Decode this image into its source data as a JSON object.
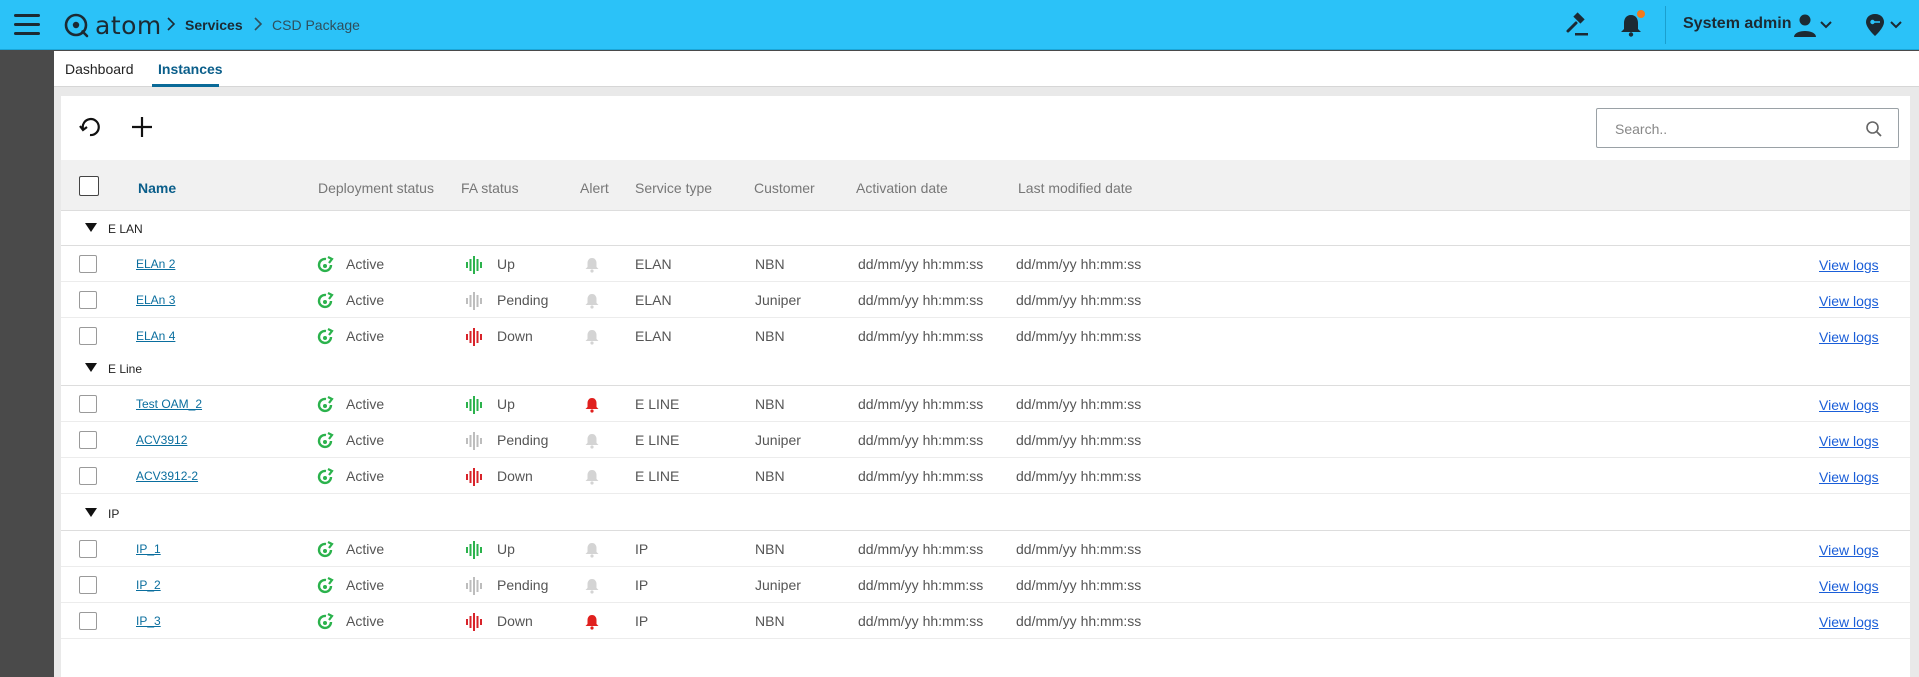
{
  "header": {
    "logo_text": "atom",
    "breadcrumb": [
      "Services",
      "CSD Package"
    ],
    "user_name": "System admin",
    "brand_color": "#2bc2f8",
    "icons": [
      "menu-icon",
      "hammer-icon",
      "bell-icon",
      "user-icon",
      "key-location-icon"
    ]
  },
  "tabs": [
    {
      "label": "Dashboard"
    },
    {
      "label": "Instances"
    }
  ],
  "toolbar": {
    "search_placeholder": "Search.."
  },
  "table": {
    "columns": [
      "Name",
      "Deployment status",
      "FA status",
      "Alert",
      "Service type",
      "Customer",
      "Activation date",
      "Last modified date"
    ],
    "groups": [
      {
        "label": "E LAN",
        "rows": [
          {
            "name": "ELAn 2",
            "deployment": "Active",
            "fa": "Up",
            "alert": false,
            "service": "ELAN",
            "customer": "NBN",
            "activation": "dd/mm/yy hh:mm:ss",
            "modified": "dd/mm/yy hh:mm:ss",
            "action": "View logs"
          },
          {
            "name": "ELAn 3",
            "deployment": "Active",
            "fa": "Pending",
            "alert": false,
            "service": "ELAN",
            "customer": "Juniper",
            "activation": "dd/mm/yy hh:mm:ss",
            "modified": "dd/mm/yy hh:mm:ss",
            "action": "View logs"
          },
          {
            "name": "ELAn 4",
            "deployment": "Active",
            "fa": "Down",
            "alert": false,
            "service": "ELAN",
            "customer": "NBN",
            "activation": "dd/mm/yy hh:mm:ss",
            "modified": "dd/mm/yy hh:mm:ss",
            "action": "View logs"
          }
        ]
      },
      {
        "label": "E Line",
        "rows": [
          {
            "name": "Test OAM_2",
            "deployment": "Active",
            "fa": "Up",
            "alert": true,
            "service": "E LINE",
            "customer": "NBN",
            "activation": "dd/mm/yy hh:mm:ss",
            "modified": "dd/mm/yy hh:mm:ss",
            "action": "View logs"
          },
          {
            "name": "ACV3912",
            "deployment": "Active",
            "fa": "Pending",
            "alert": false,
            "service": "E LINE",
            "customer": "Juniper",
            "activation": "dd/mm/yy hh:mm:ss",
            "modified": "dd/mm/yy hh:mm:ss",
            "action": "View logs"
          },
          {
            "name": "ACV3912-2",
            "deployment": "Active",
            "fa": "Down",
            "alert": false,
            "service": "E LINE",
            "customer": "NBN",
            "activation": "dd/mm/yy hh:mm:ss",
            "modified": "dd/mm/yy hh:mm:ss",
            "action": "View logs"
          }
        ]
      },
      {
        "label": "IP",
        "rows": [
          {
            "name": "IP_1",
            "deployment": "Active",
            "fa": "Up",
            "alert": false,
            "service": "IP",
            "customer": "NBN",
            "activation": "dd/mm/yy hh:mm:ss",
            "modified": "dd/mm/yy hh:mm:ss",
            "action": "View logs"
          },
          {
            "name": "IP_2",
            "deployment": "Active",
            "fa": "Pending",
            "alert": false,
            "service": "IP",
            "customer": "Juniper",
            "activation": "dd/mm/yy hh:mm:ss",
            "modified": "dd/mm/yy hh:mm:ss",
            "action": "View logs"
          },
          {
            "name": "IP_3",
            "deployment": "Active",
            "fa": "Down",
            "alert": true,
            "service": "IP",
            "customer": "NBN",
            "activation": "dd/mm/yy hh:mm:ss",
            "modified": "dd/mm/yy hh:mm:ss",
            "action": "View logs"
          }
        ]
      }
    ]
  },
  "status_colors": {
    "active": "#2bb24c",
    "up": "#2bb24c",
    "pending": "#bdbdbd",
    "down": "#d8232a",
    "alert_on": "#e0201e",
    "alert_off": "#d4d4d4"
  }
}
